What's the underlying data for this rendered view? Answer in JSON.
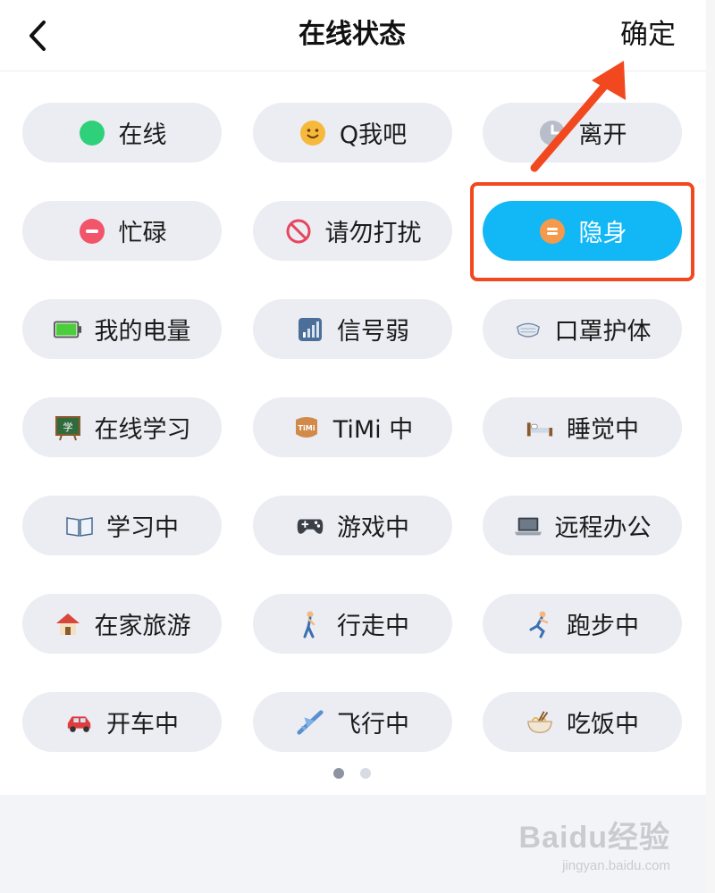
{
  "header": {
    "title": "在线状态",
    "confirm_label": "确定"
  },
  "statuses": [
    {
      "label": "在线",
      "icon": "green-dot-icon"
    },
    {
      "label": "Q我吧",
      "icon": "smiley-icon"
    },
    {
      "label": "离开",
      "icon": "clock-icon"
    },
    {
      "label": "忙碌",
      "icon": "busy-icon"
    },
    {
      "label": "请勿打扰",
      "icon": "no-entry-icon"
    },
    {
      "label": "隐身",
      "icon": "invisible-icon",
      "selected": true
    },
    {
      "label": "我的电量",
      "icon": "battery-icon"
    },
    {
      "label": "信号弱",
      "icon": "signal-icon"
    },
    {
      "label": "口罩护体",
      "icon": "mask-icon"
    },
    {
      "label": "在线学习",
      "icon": "blackboard-icon"
    },
    {
      "label": "TiMi 中",
      "icon": "timi-icon"
    },
    {
      "label": "睡觉中",
      "icon": "bed-icon"
    },
    {
      "label": "学习中",
      "icon": "book-icon"
    },
    {
      "label": "游戏中",
      "icon": "gamepad-icon"
    },
    {
      "label": "远程办公",
      "icon": "laptop-icon"
    },
    {
      "label": "在家旅游",
      "icon": "house-icon"
    },
    {
      "label": "行走中",
      "icon": "walking-icon"
    },
    {
      "label": "跑步中",
      "icon": "running-icon"
    },
    {
      "label": "开车中",
      "icon": "car-icon"
    },
    {
      "label": "飞行中",
      "icon": "airplane-icon"
    },
    {
      "label": "吃饭中",
      "icon": "noodle-bowl-icon"
    }
  ],
  "pager": {
    "total": 2,
    "current": 1
  },
  "watermark": {
    "logo": "Baidu经验",
    "sub": "jingyan.baidu.com"
  },
  "colors": {
    "selected": "#12b7f5",
    "annotation": "#f2481f"
  }
}
